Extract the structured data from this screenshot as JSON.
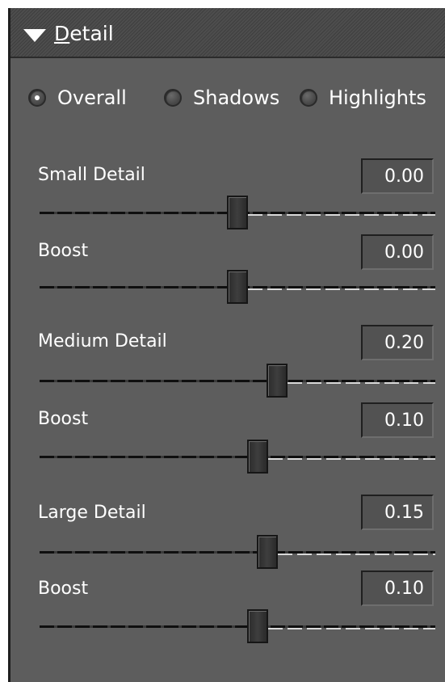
{
  "header": {
    "title_first": "D",
    "title_rest": "etail"
  },
  "modes": [
    {
      "label": "Overall",
      "checked": true
    },
    {
      "label": "Shadows",
      "checked": false
    },
    {
      "label": "Highlights",
      "checked": false
    }
  ],
  "controls": [
    {
      "label": "Small Detail",
      "value": "0.00",
      "level": 0.5
    },
    {
      "label": "Boost",
      "value": "0.00",
      "level": 0.5
    },
    {
      "label": "Medium Detail",
      "value": "0.20",
      "level": 0.6
    },
    {
      "label": "Boost",
      "value": "0.10",
      "level": 0.55
    },
    {
      "label": "Large Detail",
      "value": "0.15",
      "level": 0.575
    },
    {
      "label": "Boost",
      "value": "0.10",
      "level": 0.55
    }
  ],
  "colors": {
    "panel_bg": "#5d5d5d",
    "text": "#ffffff",
    "track_dark": "#0f0f0f",
    "track_light": "#d8d8d8"
  },
  "icons": {
    "header_toggle": "disclosure-triangle-down-icon"
  }
}
